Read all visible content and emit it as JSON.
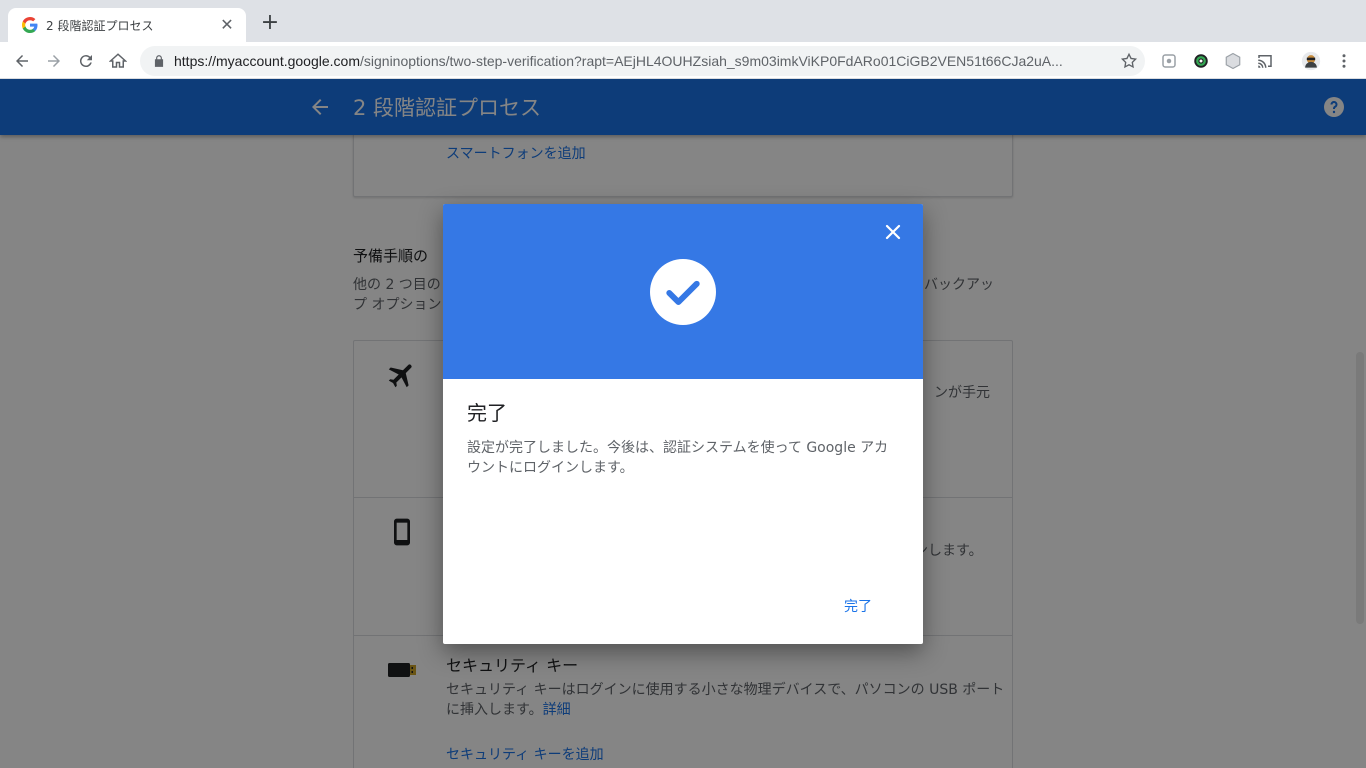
{
  "browser": {
    "tab_title": "2 段階認証プロセス",
    "tab_close": "✕",
    "new_tab": "+",
    "url_host": "https://myaccount.google.com",
    "url_path": "/signinoptions/two-step-verification?rapt=AEjHL4OUHZsiah_s9m03imkViKP0FdARo01CiGB2VEN51t66CJa2uA..."
  },
  "appbar": {
    "title": "2 段階認証プロセス"
  },
  "page": {
    "add_phone_link": "スマートフォンを追加",
    "backup_title": "予備手順の",
    "backup_desc_left": "他の 2 つ目の",
    "backup_desc_right": "バックアッ",
    "backup_desc_line2": "プ オプション",
    "option1_text_right": "ンが手元",
    "option2_text_right": "ンします。",
    "security_key_title": "セキュリティ キー",
    "security_key_desc": "セキュリティ キーはログインに使用する小さな物理デバイスで、パソコンの USB ポートに挿入します。",
    "security_key_more": "詳細",
    "add_security_key_link": "セキュリティ キーを追加"
  },
  "dialog": {
    "title": "完了",
    "body": "設定が完了しました。今後は、認証システムを使って Google アカウントにログインします。",
    "done_button": "完了"
  },
  "colors": {
    "appbar": "#1a73e8",
    "dialog_header": "#3578e5",
    "link": "#1a73e8"
  }
}
